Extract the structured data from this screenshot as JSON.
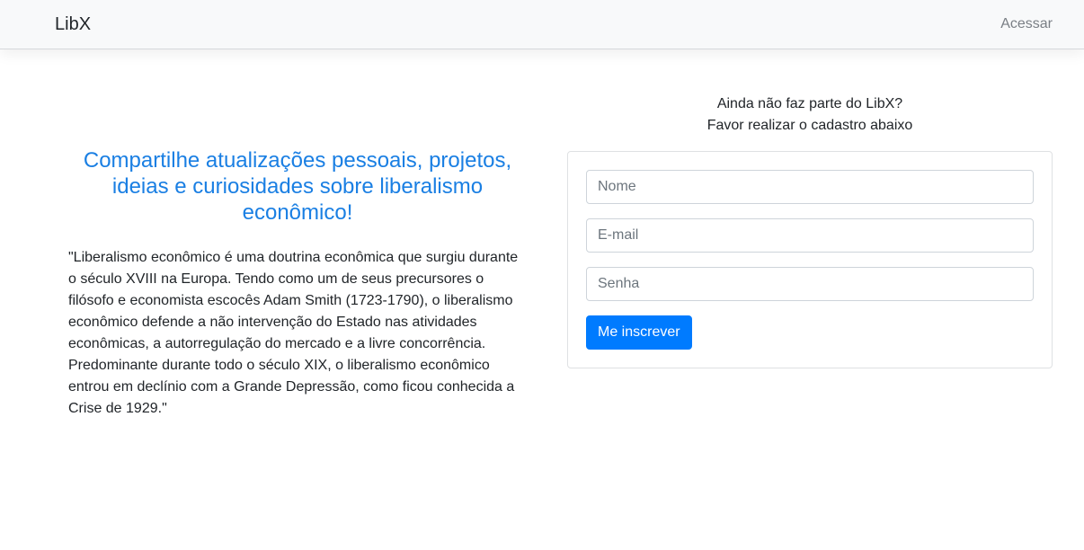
{
  "navbar": {
    "brand": "LibX",
    "login_link": "Acessar"
  },
  "hero": {
    "headline": "Compartilhe atualizações pessoais, projetos, ideias e curiosidades sobre liberalismo econômico!",
    "quote": "\"Liberalismo econômico é uma doutrina econômica que surgiu durante o século XVIII na Europa. Tendo como um de seus precursores o filósofo e economista escocês Adam Smith (1723-1790), o liberalismo econômico defende a não intervenção do Estado nas atividades econômicas, a autorregulação do mercado e a livre concorrência. Predominante durante todo o século XIX, o liberalismo econômico entrou em declínio com a Grande Depressão, como ficou conhecida a Crise de 1929.\""
  },
  "signup": {
    "intro_line1": "Ainda não faz parte do LibX?",
    "intro_line2": "Favor realizar o cadastro abaixo",
    "name_placeholder": "Nome",
    "name_value": "",
    "email_placeholder": "E-mail",
    "email_value": "",
    "password_placeholder": "Senha",
    "password_value": "",
    "submit_label": "Me inscrever"
  },
  "colors": {
    "accent": "#007bff",
    "headline": "#1a7fe3",
    "navbar_bg": "#f8f9fa"
  }
}
